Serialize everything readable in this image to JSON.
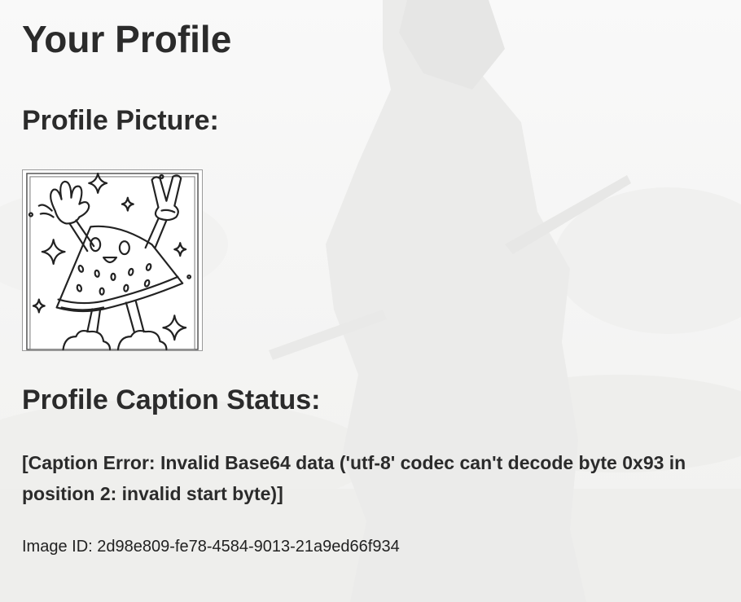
{
  "page": {
    "title": "Your Profile"
  },
  "profile_picture": {
    "heading": "Profile Picture:",
    "avatar_icon": "watermelon-mascot-icon"
  },
  "caption_status": {
    "heading": "Profile Caption Status:",
    "message": "[Caption Error: Invalid Base64 data ('utf-8' codec can't decode byte 0x93 in position 2: invalid start byte)]"
  },
  "image_id": {
    "text": "Image ID: 2d98e809-fe78-4584-9013-21a9ed66f934"
  },
  "colors": {
    "background": "#f7f7f6",
    "text": "#2b2b2b"
  }
}
